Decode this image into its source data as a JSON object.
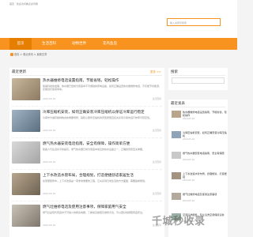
{
  "topbar": {
    "text": "首页 · 欢迎访问看点资讯网"
  },
  "search": {
    "placeholder": "输入关键字搜索"
  },
  "nav": [
    {
      "label": "首页"
    },
    {
      "label": "生活百科"
    },
    {
      "label": "动物世界"
    },
    {
      "label": "花鸟鱼虫"
    }
  ],
  "breadcrumb": "首页 > 看点资讯 > 最新文章",
  "main": {
    "title": "最近更新",
    "more": "更多 >>",
    "articles": [
      {
        "title": "热水器维修电话设置指南，节能省钱，轻松操作",
        "desc": "随着科技的发展，热水器已经成为家庭中不可或缺的家电设备，如何正确设置热水器维修电话，不仅能节省能源，还能延长使用寿命。",
        "date": "2024-05-16",
        "category": "生活百科"
      },
      {
        "title": "冷库压缩机安装，如何正确安装冷库压缩机以保证冷库运行稳定",
        "desc": "冷库作为储存各种物资的重要场所，其核心部件压缩机的安装质量直接关系到冷库的运行效率与稳定性。",
        "date": "2024-05-16",
        "category": "生活百科"
      },
      {
        "title": "燃气热水器安装电话指南，安全有保障，操作简单方便",
        "desc": "随着人们生活水平的提高，燃气热水器已成为家庭中常见的热水设备之一，正确的安装至关重要。",
        "date": "2024-05-16",
        "category": "生活百科"
      },
      {
        "title": "上下水改造水管布局，合理规划，打造便捷舒适家居生活",
        "desc": "在家居装修中，上下水改造是一项非常重要的工程，它关系到日常生活的方方面面，需要提前规划。",
        "date": "2024-05-16",
        "category": "生活百科"
      },
      {
        "title": "燃气灶维修电话及使用注意事项，保障家庭用气安全",
        "desc": "燃气灶是现代家庭中不可缺少的厨房电器，了解常见故障及维修方法，可以更好地保障家庭安全。",
        "date": "2024-05-16",
        "category": "生活百科"
      }
    ]
  },
  "side_search": {
    "title": "搜索"
  },
  "recent": {
    "title": "最近发表",
    "items": [
      {
        "title": "热水器维修电话设置指南，节能省钱，轻松操作",
        "date": "2024-05-16"
      },
      {
        "title": "冷库压缩机安装，如何正确安装冷库压缩机",
        "date": "2024-05-16"
      },
      {
        "title": "燃气热水器安装电话指南，安全有保障",
        "date": "2024-05-16"
      },
      {
        "title": "上下水改造水管布局，合理规划，打造便捷",
        "date": "2024-05-16"
      },
      {
        "title": "燃气灶维修电话及使用注意事项",
        "date": "2024-05-16"
      },
      {
        "title": "空调清洗服务，专业清洗空调保持清新",
        "date": "2024-05-16"
      }
    ]
  },
  "watermark": "千城秒收录",
  "colors": {
    "accent": "#f7931e",
    "accent_dark": "#e67e00"
  }
}
